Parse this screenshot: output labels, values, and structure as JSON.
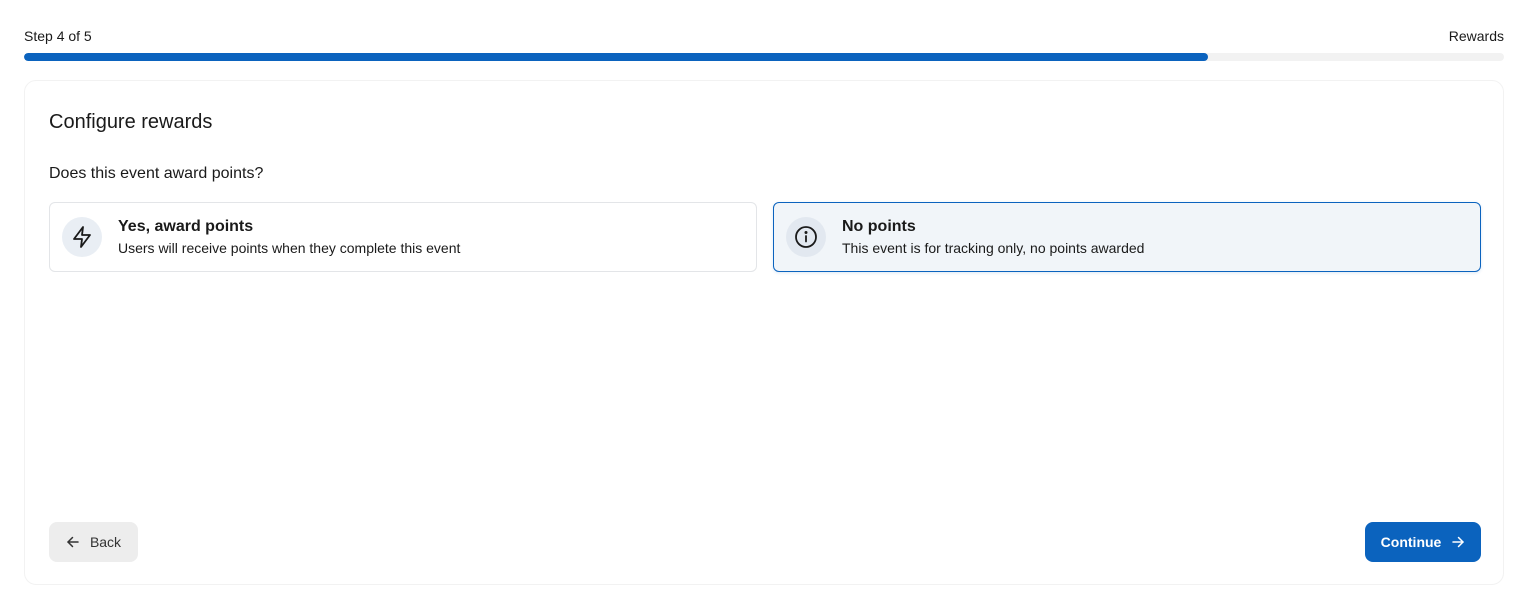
{
  "wizard": {
    "step_text": "Step 4 of 5",
    "step_name": "Rewards",
    "progress_fraction": 0.8
  },
  "card": {
    "title": "Configure rewards",
    "question": "Does this event award points?",
    "options": [
      {
        "title": "Yes, award points",
        "description": "Users will receive points when they complete this event",
        "icon": "lightning-icon",
        "selected": false
      },
      {
        "title": "No points",
        "description": "This event is for tracking only, no points awarded",
        "icon": "info-icon",
        "selected": true
      }
    ]
  },
  "footer": {
    "back_label": "Back",
    "back_icon": "arrow-left-icon",
    "continue_label": "Continue",
    "continue_icon": "arrow-right-icon"
  },
  "colors": {
    "accent": "#0b63be",
    "track": "#f2f2f2",
    "selected_bg": "#f1f5f9"
  }
}
